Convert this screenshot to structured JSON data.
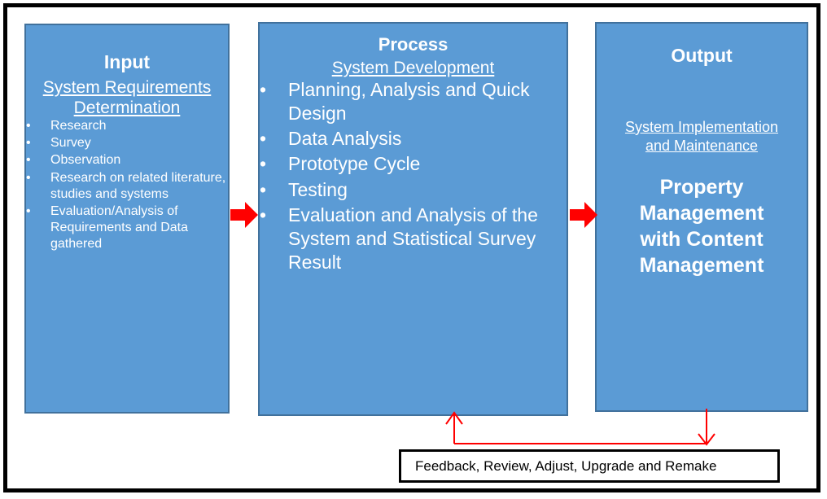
{
  "diagram": {
    "type": "ipo-flow",
    "colors": {
      "box_fill": "#5B9BD5",
      "box_border": "#41719C",
      "arrow_red": "#FF0000",
      "frame_black": "#000000",
      "box_text": "#FFFFFF"
    }
  },
  "input_box": {
    "title": "Input",
    "subtitle": "System Requirements Determination",
    "bullets": [
      "Research",
      "Survey",
      "Observation",
      "Research on related literature, studies and systems",
      "Evaluation/Analysis of Requirements and Data gathered"
    ]
  },
  "process_box": {
    "title": "Process",
    "subtitle": "System Development",
    "bullets": [
      "Planning, Analysis and Quick Design",
      "Data Analysis",
      "Prototype Cycle",
      "Testing",
      "Evaluation and Analysis of the System and Statistical Survey Result"
    ]
  },
  "output_box": {
    "title": "Output",
    "subtitle": "System Implementation and Maintenance",
    "highlight": "Property Management with Content Management"
  },
  "connectors": {
    "arrow_input_to_process": "red-right-arrow",
    "arrow_process_to_output": "red-right-arrow",
    "feedback_loop": "red-feedback-loop"
  },
  "feedback_box": {
    "text": "Feedback, Review, Adjust, Upgrade and Remake"
  }
}
